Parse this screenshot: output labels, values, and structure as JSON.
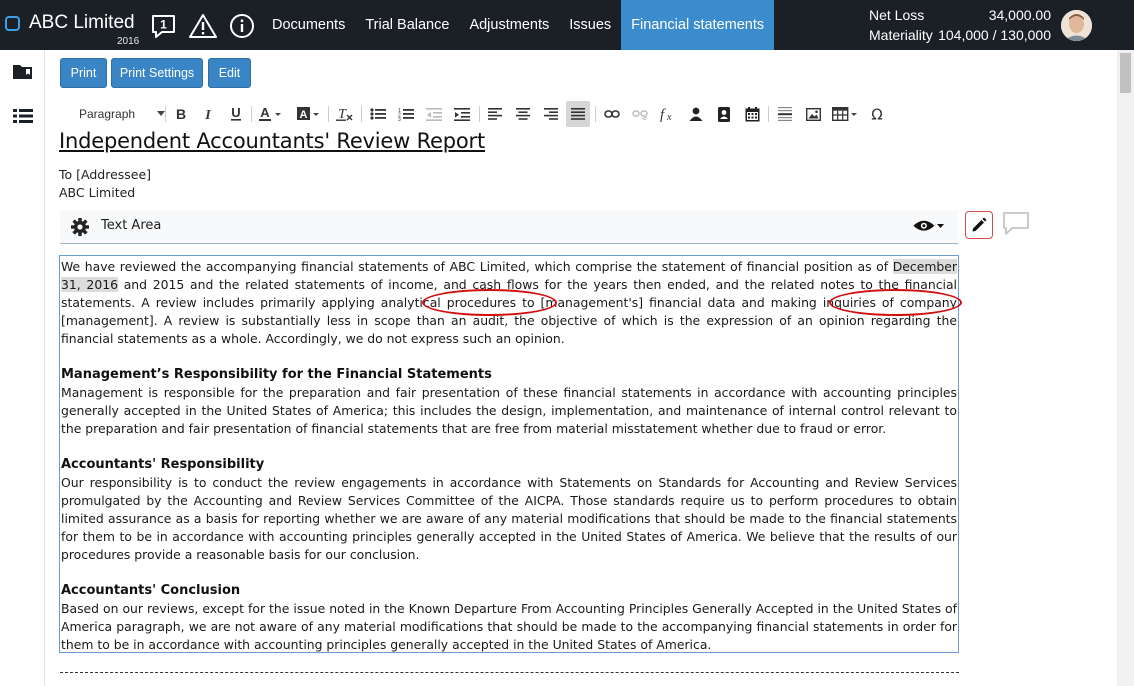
{
  "header": {
    "company": "ABC Limited",
    "year": "2016",
    "notification_count": "1",
    "nav": [
      {
        "label": "Documents"
      },
      {
        "label": "Trial Balance"
      },
      {
        "label": "Adjustments"
      },
      {
        "label": "Issues"
      },
      {
        "label": "Financial statements",
        "active": true
      }
    ],
    "stats": {
      "net_loss_label": "Net Loss",
      "net_loss_value": "34,000.00",
      "materiality_label": "Materiality",
      "materiality_value": "104,000 / 130,000"
    }
  },
  "actions": {
    "print": "Print",
    "print_settings": "Print Settings",
    "edit": "Edit"
  },
  "toolbar": {
    "paragraph_select": "Paragraph"
  },
  "document": {
    "title": "Independent Accountants' Review Report",
    "to_line": "To [Addressee]",
    "addressee": "ABC Limited",
    "text_area_label": "Text Area",
    "intro": {
      "part1": "We have reviewed the accompanying financial statements of ABC Limited, which comprise the statement of financial position as of ",
      "highlight": "December 31, 2016",
      "part2": " and 2015 and the related statements of income, and cash flows for the years then ended, and the related notes to the financial statements. A review includes primarily applying analytical procedures to [management's] financial data and making inquiries of company [management]. A review is substantially less in scope than an audit, the objective of which is the expression of an opinion regarding the financial statements as a whole. Accordingly, we do not express such an opinion."
    },
    "sections": [
      {
        "heading": "Management’s Responsibility for the Financial Statements",
        "body": "Management is responsible for the preparation and fair presentation of these financial statements in accordance with accounting principles generally accepted in the United States of America; this includes the design, implementation, and maintenance of internal control relevant to the preparation and fair presentation of financial statements that are free from material misstatement whether due to fraud or error."
      },
      {
        "heading": "Accountants' Responsibility",
        "body": "Our responsibility is to conduct the review engagements in accordance with Statements on Standards for Accounting and Review Services promulgated by the Accounting and Review Services Committee of the AICPA. Those standards require us to perform procedures to obtain limited assurance as a basis for reporting whether we are aware of any material modifications that should be made to the financial statements for them to be in accordance with accounting principles generally accepted in the United States of America. We believe that the results of our procedures provide a reasonable basis for our conclusion."
      },
      {
        "heading": "Accountants' Conclusion",
        "body": "Based on our reviews, except for the issue noted in the Known Departure From Accounting Principles Generally Accepted in the United States of America paragraph, we are not aware of any material modifications that should be made to the accompanying financial statements in order for them to be in accordance with accounting principles generally accepted in the United States of America."
      }
    ]
  },
  "colors": {
    "topbar": "#1b1f26",
    "active_tab": "#3a8ccc",
    "button": "#3a85c6",
    "annotation": "#d20e0e"
  }
}
